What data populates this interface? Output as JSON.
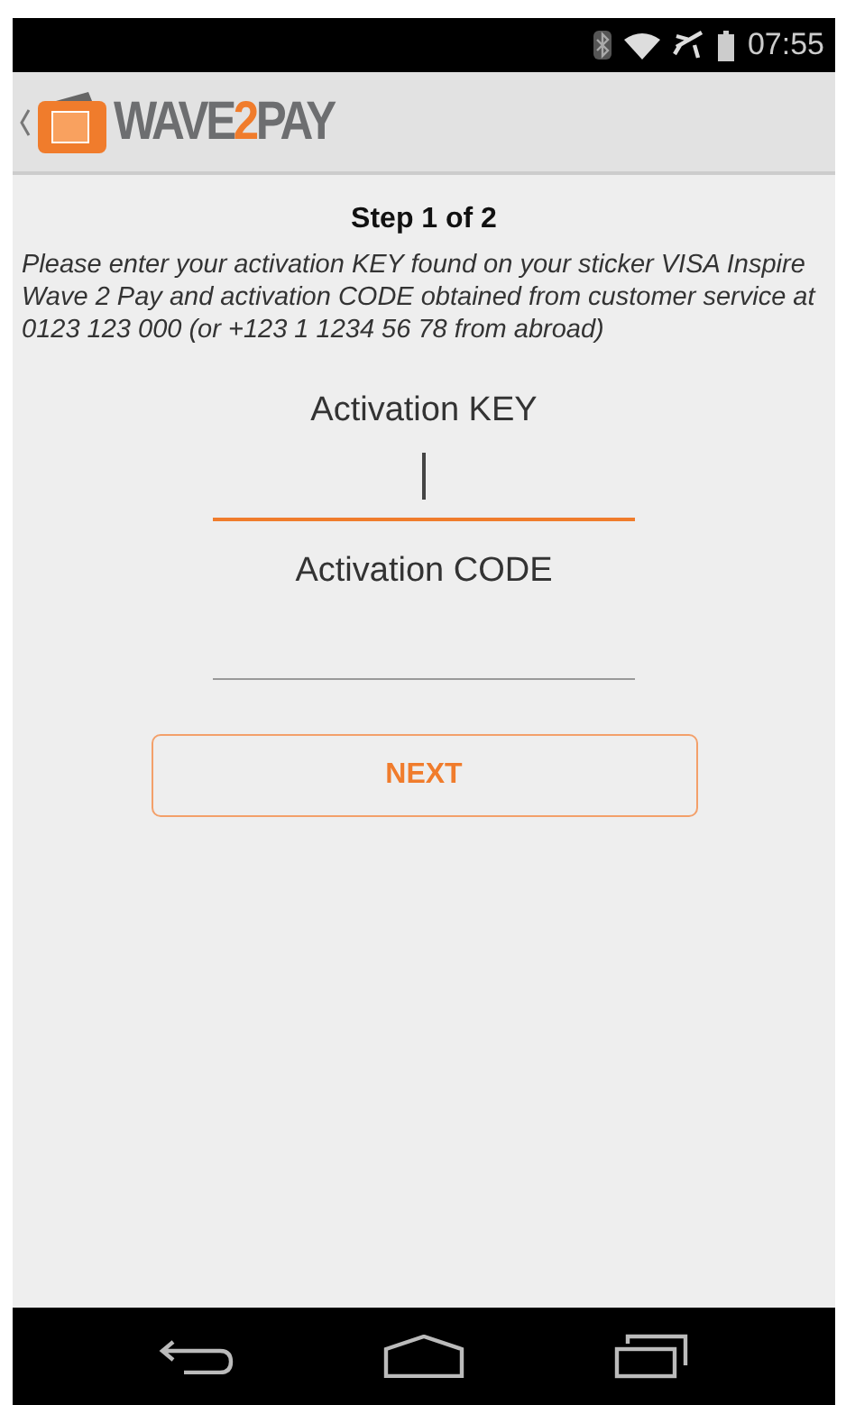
{
  "status_bar": {
    "time": "07:55"
  },
  "app_bar": {
    "logo": {
      "before": "WAVE",
      "accent": "2",
      "after": "PAY"
    }
  },
  "step_title": "Step 1 of 2",
  "instructions": "Please enter your activation KEY found on your sticker VISA Inspire Wave 2 Pay and activation CODE obtained from customer service at 0123 123 000 (or +123 1 1234 56 78 from abroad)",
  "fields": [
    {
      "label": "Activation KEY",
      "focused": true
    },
    {
      "label": "Activation CODE",
      "focused": false
    }
  ],
  "buttons": [
    {
      "label": "NEXT"
    }
  ]
}
